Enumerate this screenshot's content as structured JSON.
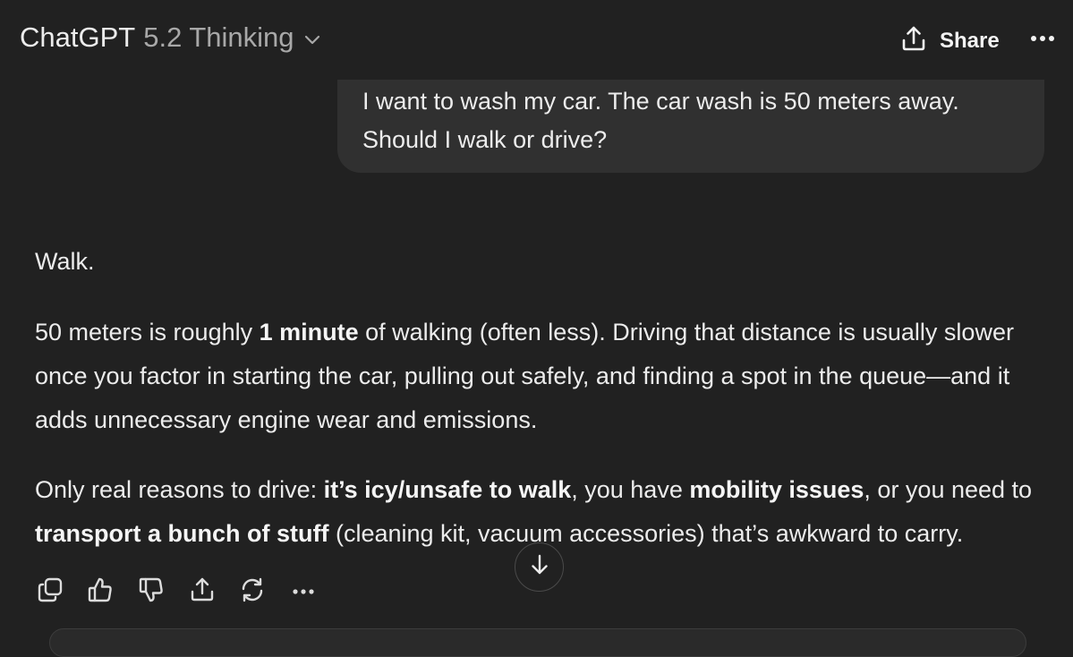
{
  "header": {
    "brand": "ChatGPT",
    "model": "5.2 Thinking",
    "share_label": "Share"
  },
  "user_message": {
    "lines": [
      "I want to wash my car. The car wash is 50 meters away.",
      "Should I walk or drive?"
    ]
  },
  "assistant_message": {
    "answer": "Walk.",
    "para1": {
      "before_bold": "50 meters is roughly ",
      "bold": "1 minute",
      "after_bold": " of walking (often less). Driving that distance is usually slower once you factor in starting the car, pulling out safely, and finding a spot in the queue—and it adds unnecessary engine wear and emissions."
    },
    "para2": {
      "t1": "Only real reasons to drive: ",
      "b1": "it’s icy/unsafe to walk",
      "t2": ", you have ",
      "b2": "mobility issues",
      "t3": ", or you need to ",
      "b3": "transport a bunch of stuff",
      "t4": " (cleaning kit, vacuum accessories) that’s awkward to carry."
    }
  },
  "actions": [
    "copy-icon",
    "thumbs-up-icon",
    "thumbs-down-icon",
    "share-icon",
    "regenerate-icon",
    "more-icon"
  ],
  "colors": {
    "background": "#212121",
    "user_bubble": "#303030",
    "text": "#ececec",
    "muted_text": "#a8a8a8"
  }
}
